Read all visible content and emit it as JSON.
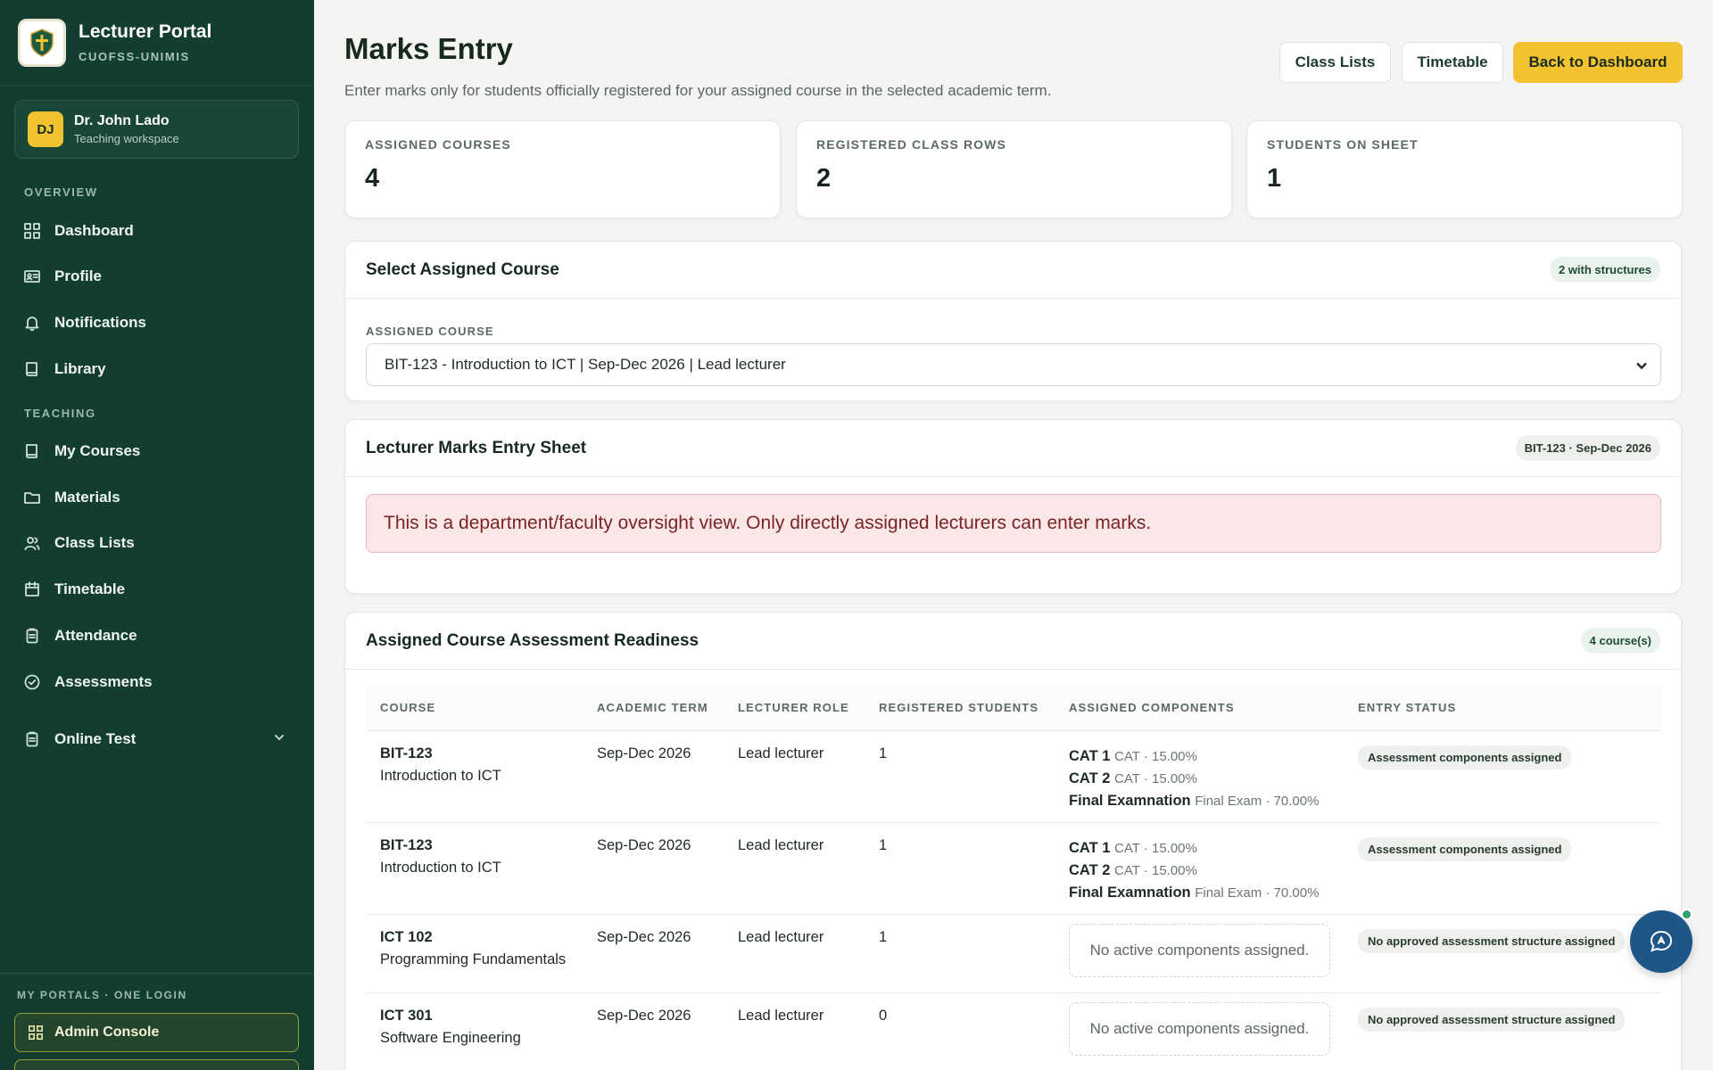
{
  "app": {
    "title": "Lecturer Portal",
    "subtitle": "CUOFSS-UNIMIS"
  },
  "user": {
    "initials": "DJ",
    "name": "Dr. John Lado",
    "subtitle": "Teaching workspace"
  },
  "nav": {
    "overview_label": "OVERVIEW",
    "overview": [
      {
        "label": "Dashboard",
        "icon": "grid-icon"
      },
      {
        "label": "Profile",
        "icon": "id-card-icon"
      },
      {
        "label": "Notifications",
        "icon": "bell-icon"
      },
      {
        "label": "Library",
        "icon": "book-icon"
      }
    ],
    "teaching_label": "TEACHING",
    "teaching": [
      {
        "label": "My Courses",
        "icon": "book-icon"
      },
      {
        "label": "Materials",
        "icon": "folder-icon"
      },
      {
        "label": "Class Lists",
        "icon": "users-icon"
      },
      {
        "label": "Timetable",
        "icon": "calendar-icon"
      },
      {
        "label": "Attendance",
        "icon": "clipboard-icon"
      },
      {
        "label": "Assessments",
        "icon": "check-circle-icon"
      },
      {
        "label": "Online Test",
        "icon": "clipboard-icon"
      }
    ]
  },
  "portals": {
    "label": "MY PORTALS · ONE LOGIN",
    "admin_console": "Admin Console"
  },
  "header": {
    "title": "Marks Entry",
    "subtitle": "Enter marks only for students officially registered for your assigned course in the selected academic term.",
    "buttons": {
      "class_lists": "Class Lists",
      "timetable": "Timetable",
      "back": "Back to Dashboard"
    }
  },
  "stats": [
    {
      "label": "ASSIGNED COURSES",
      "value": "4"
    },
    {
      "label": "REGISTERED CLASS ROWS",
      "value": "2"
    },
    {
      "label": "STUDENTS ON SHEET",
      "value": "1"
    }
  ],
  "select_course": {
    "title": "Select Assigned Course",
    "badge": "2 with structures",
    "field_label": "ASSIGNED COURSE",
    "selected": "BIT-123 - Introduction to ICT | Sep-Dec 2026 | Lead lecturer"
  },
  "marks_sheet": {
    "title": "Lecturer Marks Entry Sheet",
    "badge": "BIT-123 · Sep-Dec 2026",
    "alert": "This is a department/faculty oversight view. Only directly assigned lecturers can enter marks."
  },
  "readiness": {
    "title": "Assigned Course Assessment Readiness",
    "badge": "4 course(s)",
    "columns": [
      "COURSE",
      "ACADEMIC TERM",
      "LECTURER ROLE",
      "REGISTERED STUDENTS",
      "ASSIGNED COMPONENTS",
      "ENTRY STATUS"
    ],
    "empty_components": "No active components assigned.",
    "rows": [
      {
        "code": "BIT-123",
        "name": "Introduction to ICT",
        "term": "Sep-Dec 2026",
        "role": "Lead lecturer",
        "students": "1",
        "components": [
          {
            "name": "CAT 1",
            "detail": "CAT · 15.00%"
          },
          {
            "name": "CAT 2",
            "detail": "CAT · 15.00%"
          },
          {
            "name": "Final Examnation",
            "detail": "Final Exam · 70.00%"
          }
        ],
        "status": "Assessment components assigned"
      },
      {
        "code": "BIT-123",
        "name": "Introduction to ICT",
        "term": "Sep-Dec 2026",
        "role": "Lead lecturer",
        "students": "1",
        "components": [
          {
            "name": "CAT 1",
            "detail": "CAT · 15.00%"
          },
          {
            "name": "CAT 2",
            "detail": "CAT · 15.00%"
          },
          {
            "name": "Final Examnation",
            "detail": "Final Exam · 70.00%"
          }
        ],
        "status": "Assessment components assigned"
      },
      {
        "code": "ICT 102",
        "name": "Programming Fundamentals",
        "term": "Sep-Dec 2026",
        "role": "Lead lecturer",
        "students": "1",
        "components": [],
        "status": "No approved assessment structure assigned"
      },
      {
        "code": "ICT 301",
        "name": "Software Engineering",
        "term": "Sep-Dec 2026",
        "role": "Lead lecturer",
        "students": "0",
        "components": [],
        "status": "No approved assessment structure assigned"
      }
    ]
  },
  "colors": {
    "sidebar": "#133d31",
    "accent": "#f2c230",
    "alert_bg": "#fbe7e7",
    "chat": "#1f5688"
  }
}
